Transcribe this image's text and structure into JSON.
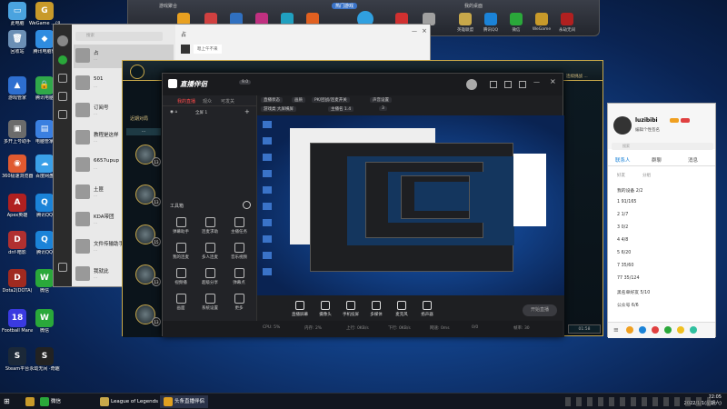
{
  "desktop_icons": [
    {
      "label": "此电脑",
      "color": "#4aa3df",
      "glyph": "▭"
    },
    {
      "label": "WeGame\n...(测)",
      "color": "#c89a2a",
      "glyph": "G"
    },
    {
      "label": "回收站",
      "color": "#6b8fb5",
      "glyph": "🗑"
    },
    {
      "label": "腾讯电脑管",
      "color": "#2f8ce0",
      "glyph": "◆"
    },
    {
      "label": "游戏管家",
      "color": "#2e6fd0",
      "glyph": "▲"
    },
    {
      "label": "腾讯电脑",
      "color": "#30a84a",
      "glyph": "🔒"
    },
    {
      "label": "多开上号助手",
      "color": "#6b6b6b",
      "glyph": "▣"
    },
    {
      "label": "电脑管家",
      "color": "#3a7fe0",
      "glyph": "▤"
    },
    {
      "label": "360极速浏览器",
      "color": "#e05a30",
      "glyph": "◉"
    },
    {
      "label": "百度网盘",
      "color": "#3aa0e8",
      "glyph": "☁"
    },
    {
      "label": "Apex英雄",
      "color": "#b02020",
      "glyph": "A"
    },
    {
      "label": "腾讯QQ",
      "color": "#1b83d8",
      "glyph": "Q"
    },
    {
      "label": "dnf·暗影",
      "color": "#b03030",
      "glyph": "D"
    },
    {
      "label": "腾讯QQ",
      "color": "#1b83d8",
      "glyph": "Q"
    },
    {
      "label": "Dota2(DOTA)",
      "color": "#a02a20",
      "glyph": "D"
    },
    {
      "label": "微信",
      "color": "#2aa83a",
      "glyph": "W"
    },
    {
      "label": "Football Manag...",
      "color": "#3a3ae0",
      "glyph": "18"
    },
    {
      "label": "微信",
      "color": "#2aa83a",
      "glyph": "W"
    },
    {
      "label": "Steam平台",
      "color": "#1b2838",
      "glyph": "S"
    },
    {
      "label": "永劫无间 ·奇趣",
      "color": "#222",
      "glyph": "S"
    }
  ],
  "launcher": {
    "left_title": "游戏聚合",
    "center_title": "热门游戏",
    "right_title": "我的桌面",
    "right_icons": [
      "英雄联盟",
      "腾讯QQ",
      "微信",
      "WeGame",
      "永劫无间"
    ]
  },
  "qq": {
    "window_title": "占",
    "search_placeholder": "搜索",
    "chat_header": "占",
    "chat_preview": "嗯上午不来",
    "rows": [
      {
        "name": "占",
        "preview": "..."
      },
      {
        "name": "501",
        "preview": "..."
      },
      {
        "name": "订阅号",
        "preview": "..."
      },
      {
        "name": "教程是这样",
        "preview": "..."
      },
      {
        "name": "6657upup",
        "preview": "..."
      },
      {
        "name": "土匪",
        "preview": "..."
      },
      {
        "name": "KDA带团",
        "preview": "..."
      },
      {
        "name": "文件传输助手",
        "preview": "..."
      },
      {
        "name": "我就此",
        "preview": "..."
      }
    ]
  },
  "lol": {
    "tab_label": "近期对局",
    "levels": [
      "13",
      "13",
      "15",
      "13",
      "13"
    ],
    "right_label": "连续挑战 ..."
  },
  "app": {
    "title": "直播伴侣",
    "version": "9.0",
    "tabs": [
      "我的直播",
      "观众",
      "可发关"
    ],
    "scene_label": "全屏 1",
    "tools_header": "工具箱",
    "toolbar": {
      "chips": [
        "直播状态",
        "画质",
        "PK/团战/连麦开关",
        "声音设置",
        "游戏类 大屏横屏",
        "主播名 1.4",
        "3"
      ]
    },
    "tools": [
      {
        "label": "弹幕助手"
      },
      {
        "label": "连麦求助"
      },
      {
        "label": "主播任务"
      },
      {
        "label": "我的连麦"
      },
      {
        "label": "多人连麦"
      },
      {
        "label": "音乐视频"
      },
      {
        "label": "视频播"
      },
      {
        "label": "超级分享"
      },
      {
        "label": "弹幕点"
      },
      {
        "label": "画面"
      },
      {
        "label": "系统设置"
      },
      {
        "label": "更多"
      }
    ],
    "notice": "头条直播伴侣已开播",
    "bottom_buttons": [
      "直播屏幕",
      "摄像头",
      "手机投屏",
      "多媒体",
      "麦克风",
      "扬声器"
    ],
    "start_button": "开始直播",
    "status": [
      "CPU: 5%",
      "内存: 2%",
      "上行: 0KB/s",
      "下行: 0KB/s",
      "网速: 0ms",
      "0/0",
      "帧率: 30"
    ]
  },
  "qqpanel": {
    "name": "luzibibi",
    "signature": "编辑个性签名",
    "search_placeholder": "搜索",
    "tabs": [
      "联系人",
      "群聊",
      "消息"
    ],
    "subtabs": [
      "好友",
      "分组"
    ],
    "groups": [
      "我的设备 2/2",
      "1 91/165",
      "2 1/7",
      "3 0/2",
      "4 4/8",
      "5 6/20",
      "7 35/60",
      "77 35/124",
      "黑名单好友 5/10",
      "公众号 6/6"
    ]
  },
  "taskbar": {
    "items": [
      {
        "label": "微信",
        "color": "#2aa83a"
      },
      {
        "label": "League of Legends",
        "color": "#c8a84a"
      },
      {
        "label": "头条直播伴侣",
        "color": "#e0a020"
      }
    ],
    "time": "22:05",
    "date": "2022/1/1(星期六)"
  }
}
